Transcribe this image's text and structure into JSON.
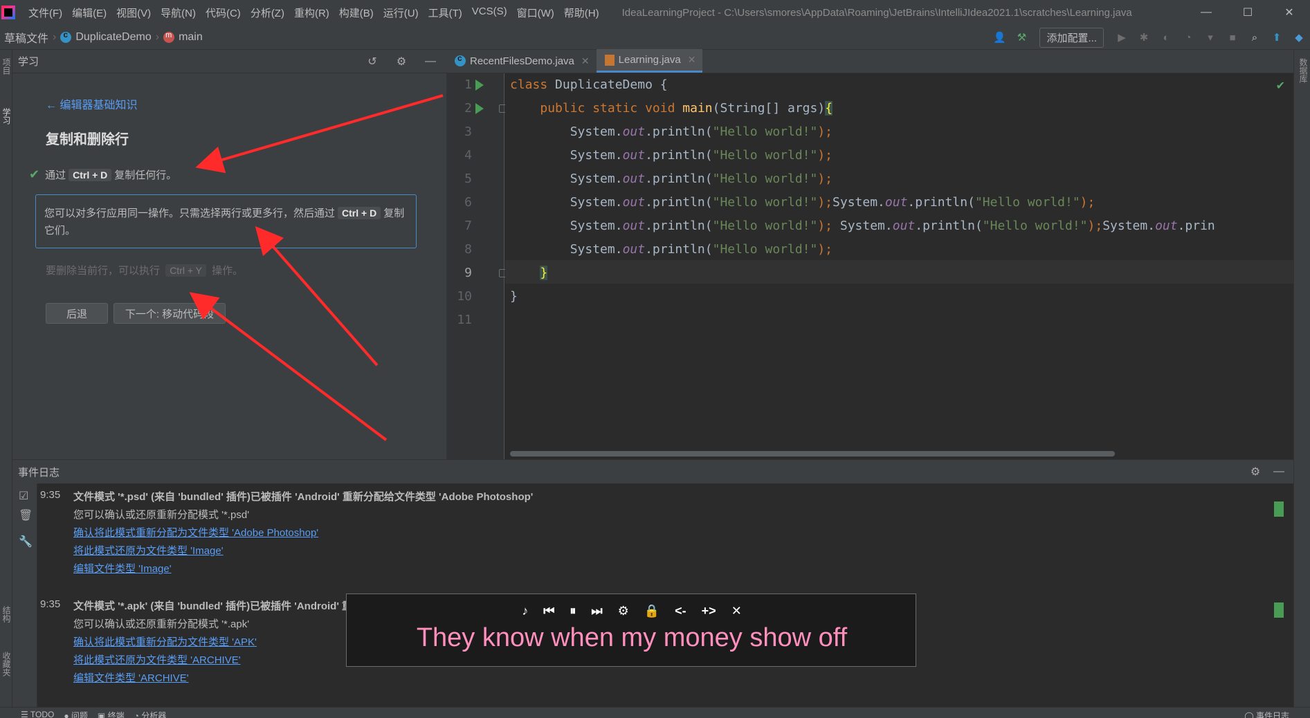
{
  "menu": [
    "文件(F)",
    "编辑(E)",
    "视图(V)",
    "导航(N)",
    "代码(C)",
    "分析(Z)",
    "重构(R)",
    "构建(B)",
    "运行(U)",
    "工具(T)",
    "VCS(S)",
    "窗口(W)",
    "帮助(H)"
  ],
  "window_title": "IdeaLearningProject - C:\\Users\\smores\\AppData\\Roaming\\JetBrains\\IntelliJIdea2021.1\\scratches\\Learning.java",
  "breadcrumb": {
    "root": "草稿文件",
    "class": "DuplicateDemo",
    "method": "main"
  },
  "toolbar": {
    "add_config": "添加配置..."
  },
  "left_stripe": {
    "project": "项目",
    "learn": "学习",
    "structure": "结构",
    "favorites": "收藏夹"
  },
  "right_stripe": {
    "database": "数据库"
  },
  "learn": {
    "panel_title": "学习",
    "back_link": "← 编辑器基础知识",
    "lesson_title": "复制和删除行",
    "task1_prefix": "通过",
    "task1_key": "Ctrl + D",
    "task1_suffix": "复制任何行。",
    "task2_text_a": "您可以对多行应用同一操作。只需选择两行或更多行，然后通过",
    "task2_key": "Ctrl + D",
    "task2_text_b": "复制",
    "task2_text_c": "它们。",
    "task3_prefix": "要删除当前行，可以执行",
    "task3_key": "Ctrl + Y",
    "task3_suffix": "操作。",
    "back_button": "后退",
    "next_button": "下一个: 移动代码段"
  },
  "editor": {
    "tabs": [
      {
        "label": "RecentFilesDemo.java",
        "active": false
      },
      {
        "label": "Learning.java",
        "active": true
      }
    ],
    "line_numbers": [
      "1",
      "2",
      "3",
      "4",
      "5",
      "6",
      "7",
      "8",
      "9",
      "10",
      "11"
    ],
    "current_line": 9,
    "code": {
      "l1_kw": "class",
      "l1_rest": " DuplicateDemo {",
      "l2_kw": "public static void",
      "l2_fn": "main",
      "l2_rest": "(String[] args)",
      "sys": "System.",
      "out": "out",
      "println": ".println(",
      "hello": "\"Hello world!\"",
      "close": ");",
      "l7_tail": "System.",
      "l7_tail2": ".prin",
      "l9": "}",
      "l10": "}"
    }
  },
  "event_log": {
    "title": "事件日志",
    "entries": [
      {
        "time": "9:35",
        "title": "文件模式 '*.psd' (来自 'bundled' 插件)已被插件 'Android' 重新分配给文件类型 'Adobe Photoshop'",
        "message": "您可以确认或还原重新分配模式 '*.psd'",
        "links": [
          "确认将此模式重新分配为文件类型 'Adobe Photoshop'",
          "将此模式还原为文件类型 'Image'",
          "编辑文件类型 'Image'"
        ]
      },
      {
        "time": "9:35",
        "title": "文件模式 '*.apk' (来自 'bundled' 插件)已被插件 'Android' 重新分配给文件类型 'APK'",
        "message": "您可以确认或还原重新分配模式 '*.apk'",
        "links": [
          "确认将此模式重新分配为文件类型 'APK'",
          "将此模式还原为文件类型 'ARCHIVE'",
          "编辑文件类型 'ARCHIVE'"
        ]
      }
    ]
  },
  "status_bar": {
    "todo": "☰ TODO",
    "problems": "● 问题",
    "terminal": "▣ 终端",
    "profiler": "◔ 分析器",
    "event_log": "◯ 事件日志"
  },
  "lyrics": {
    "text": "They know when my money show off"
  },
  "colors": {
    "accent": "#4a88c7",
    "link": "#589df6",
    "ok": "#59a869",
    "arrow": "#ff2a2a",
    "lyrics": "#ff8fbd"
  }
}
